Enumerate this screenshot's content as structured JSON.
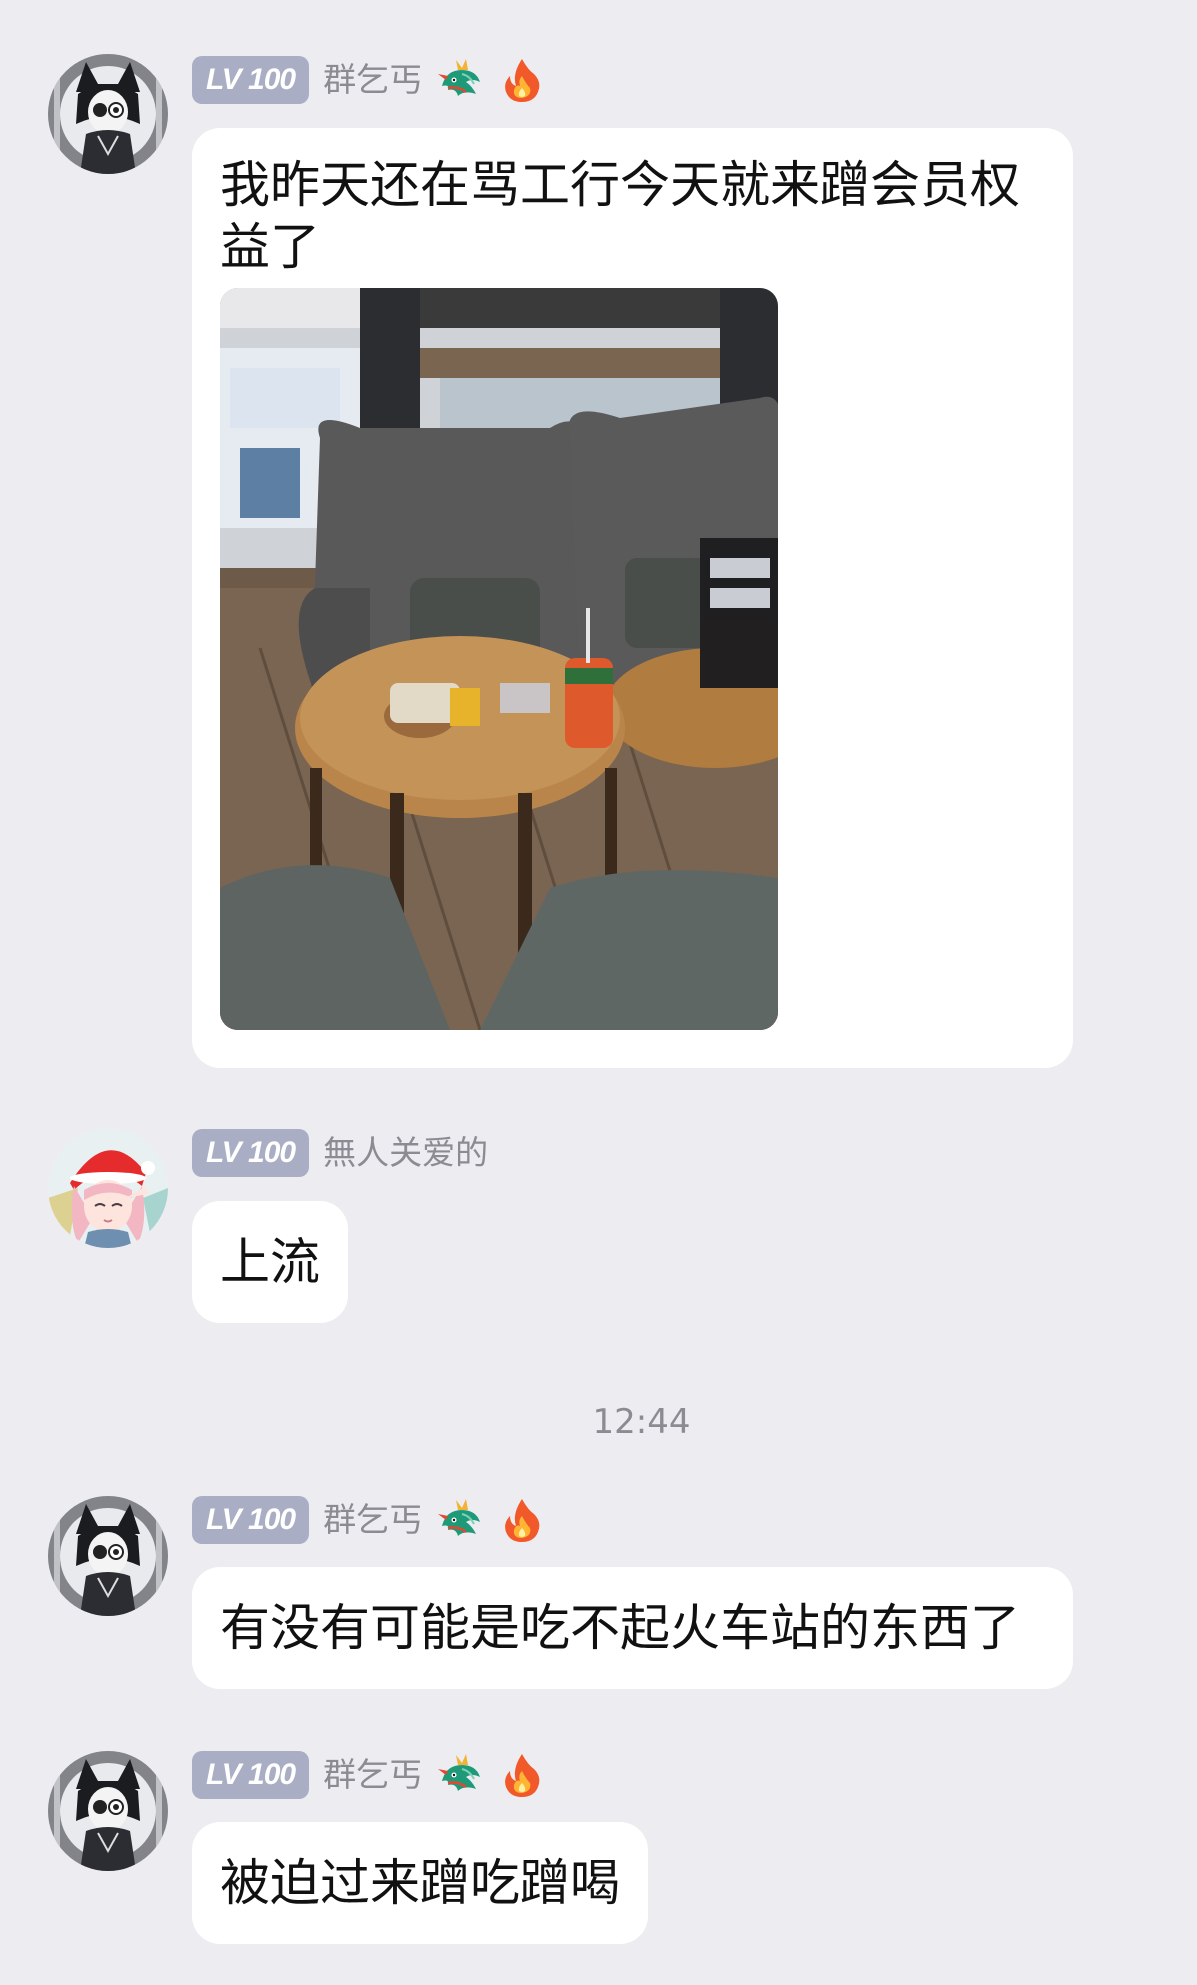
{
  "colors": {
    "background": "#ececf1",
    "bubble": "#ffffff",
    "level_badge": "#a9aec5",
    "username": "#8b8c93",
    "message_text": "#111111"
  },
  "time_separator": "12:44",
  "messages": [
    {
      "sender": "群乞丐",
      "level": "LV 100",
      "avatar": "black-cat-girl-avatar",
      "badges": [
        "dragon-icon",
        "fire-icon"
      ],
      "text": "我昨天还在骂工行今天就来蹭会员权益了",
      "image": "photo-lounge-table-snacks"
    },
    {
      "sender": "無人关爱的",
      "level": "LV 100",
      "avatar": "pink-hair-santa-hat-avatar",
      "badges": [],
      "text": "上流"
    },
    {
      "sender": "群乞丐",
      "level": "LV 100",
      "avatar": "black-cat-girl-avatar",
      "badges": [
        "dragon-icon",
        "fire-icon"
      ],
      "text": "有没有可能是吃不起火车站的东西了"
    },
    {
      "sender": "群乞丐",
      "level": "LV 100",
      "avatar": "black-cat-girl-avatar",
      "badges": [
        "dragon-icon",
        "fire-icon"
      ],
      "text": "被迫过来蹭吃蹭喝"
    }
  ]
}
